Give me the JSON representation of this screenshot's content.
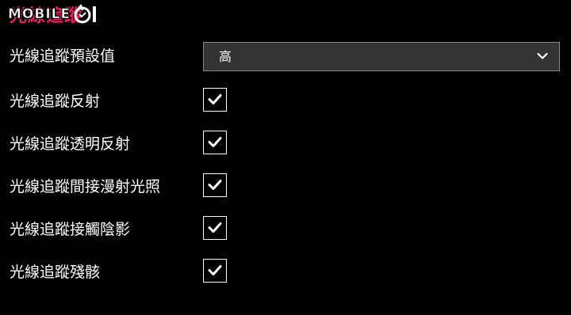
{
  "header": {
    "section_title": "光線追蹤",
    "logo_text": "MOBILE",
    "logo_mark_icon": "mobile01-logo-mark"
  },
  "settings": {
    "preset": {
      "label": "光線追蹤預設值",
      "value": "高",
      "chevron_icon": "chevron-down-icon"
    },
    "toggles": [
      {
        "label": "光線追蹤反射",
        "checked": true
      },
      {
        "label": "光線追蹤透明反射",
        "checked": true
      },
      {
        "label": "光線追蹤間接漫射光照",
        "checked": true
      },
      {
        "label": "光線追蹤接觸陰影",
        "checked": true
      },
      {
        "label": "光線追蹤殘骸",
        "checked": true
      }
    ]
  },
  "colors": {
    "background": "#000000",
    "accent": "#e0245e",
    "dropdown_bg": "#333333",
    "text": "#ffffff"
  }
}
